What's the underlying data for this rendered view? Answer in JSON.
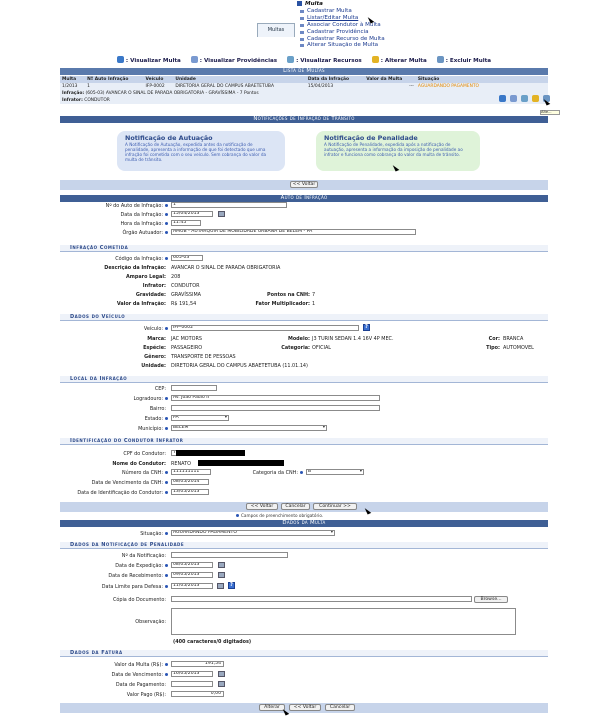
{
  "menu": {
    "tab": "Multas",
    "title": "Multa",
    "items": [
      "Cadastrar Multa",
      "Listar/Editar Multa",
      "Associar Condutor à Multa",
      "Cadastrar Providência",
      "Cadastrar Recurso de Multa",
      "Alterar Situação de Multa"
    ]
  },
  "legend": [
    {
      "label": ": Visualizar Multa",
      "icon": "magnifier-icon",
      "color": "#3a78c8"
    },
    {
      "label": ": Visualizar Providências",
      "icon": "providence-icon",
      "color": "#7a9ad0"
    },
    {
      "label": ": Visualizar Recursos",
      "icon": "resources-icon",
      "color": "#6aa0c8"
    },
    {
      "label": ": Alterar Multa",
      "icon": "edit-icon",
      "color": "#e3b325"
    },
    {
      "label": ": Excluir Multa",
      "icon": "delete-icon",
      "color": "#6b95c2"
    }
  ],
  "list": {
    "title": "Lista de Multas",
    "columns": [
      "Multa",
      "Nº Auto Infração",
      "Veículo",
      "Unidade",
      "Data da Infração",
      "Valor da Multa",
      "Situação"
    ],
    "row": [
      "1/2013",
      "1",
      "IFP-0002",
      "DIRETORIA GERAL DO CAMPUS ABAETETUBA",
      "15/04/2013",
      "---",
      "AGUARDANDO PAGAMENTO"
    ],
    "infracao_label": "Infração:",
    "infracao": "(605-03) AVANCAR O SINAL DE PARADA OBRIGATORIA - GRAVÍSSIMA - 7 Pontos",
    "infrator_label": "Infrator:",
    "infrator": "CONDUTOR",
    "tooltip": "Alte..."
  },
  "notif": {
    "title": "Notificações de Infração de Trânsito",
    "autuacao_title": "Notificação de Autuação",
    "autuacao_desc": "A Notificação de Autuação, expedida antes da notificação de penalidade, apresenta a informação de que foi detectado que uma infração foi cometida com o seu veículo. Sem cobrança do valor da multa de trânsito.",
    "penalidade_title": "Notificação de Penalidade",
    "penalidade_desc": "A Notificação de Penalidade, expedida após a notificação de autuação, apresenta a informação da imposição de penalidade ao infrator e funciona como cobrança do valor da multa de trânsito.",
    "voltar": "<< Voltar"
  },
  "auto": {
    "title": "Auto de Infração",
    "num_label": "Nº do Auto de Infração:",
    "num": "1",
    "data_label": "Data da Infração:",
    "data": "15/04/2013",
    "hora_label": "Hora da Infração:",
    "hora": "11:45",
    "orgao_label": "Órgão Autuador:",
    "orgao": "AMUB - AUTARQUIA DE MOBILIDADE URBANA DE BELÉM - PA"
  },
  "cometida": {
    "title": "Infração Cometida",
    "codigo_label": "Código da Infração:",
    "codigo": "605-03",
    "desc_label": "Descrição da Infração:",
    "desc": "AVANCAR O SINAL DE PARADA OBRIGATORIA",
    "amparo_label": "Amparo Legal:",
    "amparo": "208",
    "infrator_label": "Infrator:",
    "infrator": "CONDUTOR",
    "grav_label": "Gravidade:",
    "grav": "GRAVÍSSIMA",
    "pontos_label": "Pontos na CNH:",
    "pontos": "7",
    "valor_label": "Valor da Infração:",
    "valor": "R$ 191,54",
    "fator_label": "Fator Multiplicador:",
    "fator": "1"
  },
  "veiculo": {
    "title": "Dados do Veículo",
    "veiculo_label": "Veículo:",
    "veiculo": "IFP-0002",
    "marca_label": "Marca:",
    "marca": "JAC MOTORS",
    "modelo_label": "Modelo:",
    "modelo": "J3 TURIN SEDAN 1.4 16V 4P MEC.",
    "cor_label": "Cor:",
    "cor": "BRANCA",
    "especie_label": "Espécie:",
    "especie": "PASSAGEIRO",
    "categoria_label": "Categoria:",
    "categoria": "OFICIAL",
    "tipo_label": "Tipo:",
    "tipo": "AUTOMOVEL",
    "genero_label": "Gênero:",
    "genero": "TRANSPORTE DE PESSOAS",
    "unidade_label": "Unidade:",
    "unidade": "DIRETORIA GERAL DO CAMPUS ABAETETUBA (11.01.14)"
  },
  "local": {
    "title": "Local da Infração",
    "cep_label": "CEP:",
    "cep": "",
    "log_label": "Logradouro:",
    "log": "Av. João Paulo II",
    "bairro_label": "Bairro:",
    "bairro": "",
    "estado_label": "Estado:",
    "estado": "PA",
    "mun_label": "Município:",
    "mun": "BELÉM"
  },
  "condutor": {
    "title": "Identificação do Condutor Infrator",
    "cpf_label": "CPF do Condutor:",
    "cpf": "7",
    "nome_label": "Nome do Condutor:",
    "nome": "RENATO",
    "cnh_label": "Número da CNH:",
    "cnh": "111111111",
    "cat_label": "Categoria da CNH:",
    "cat": "B",
    "venc_label": "Data de Vencimento da CNH:",
    "venc": "08/05/2014",
    "ident_label": "Data de Identificação do Condutor:",
    "ident": "13/05/2013"
  },
  "nav": {
    "voltar": "<< Voltar",
    "cancelar": "Cancelar",
    "continuar": "Continuar >>"
  },
  "obrig": "Campos de preenchimento obrigatório.",
  "dados_multa": {
    "title": "Dados da Multa",
    "sit_label": "Situação:",
    "sit": "AGUARDANDO PAGAMENTO"
  },
  "notif_pen": {
    "title": "Dados da Notificação de Penalidade",
    "num_label": "Nº da Notificação:",
    "num": "",
    "exp_label": "Data de Expedição:",
    "exp": "08/05/2013",
    "rec_label": "Data de Recebimento:",
    "rec": "09/05/2013",
    "lim_label": "Data Limite para Defesa:",
    "lim": "11/05/2013",
    "copia_label": "Cópia do Documento:",
    "browse": "Browse...",
    "obs_label": "Observação:",
    "chars": "(400 caracteres/0 digitados)"
  },
  "fatura": {
    "title": "Dados da Fatura",
    "valor_label": "Valor da Multa (R$):",
    "valor": "191,54",
    "venc_label": "Data de Vencimento:",
    "venc": "16/05/2013",
    "pag_label": "Data de Pagamento:",
    "pag": "",
    "pago_label": "Valor Pago (R$):",
    "pago": "0,00"
  },
  "footer": {
    "alterar": "Alterar",
    "voltar": "<< Voltar",
    "cancelar": "Cancelar"
  }
}
